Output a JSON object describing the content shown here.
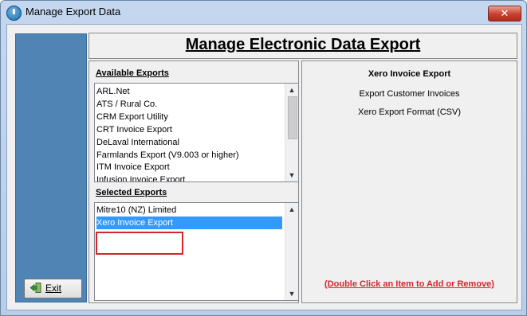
{
  "window": {
    "title": "Manage Export Data",
    "close_symbol": "✕"
  },
  "header": {
    "title": "Manage Electronic Data Export"
  },
  "sidebar": {
    "exit_label": "Exit"
  },
  "available": {
    "label": "Available Exports",
    "items": [
      "ARL.Net",
      "ATS / Rural Co.",
      "CRM Export Utility",
      "CRT Invoice Export",
      "DeLaval International",
      "Farmlands Export (V9.003 or higher)",
      "ITM Invoice Export",
      "Infusion Invoice Export"
    ],
    "scroll_position": 0.0
  },
  "selected": {
    "label": "Selected Exports",
    "items": [
      "Mitre10 (NZ) Limited",
      "Xero Invoice Export"
    ],
    "selected_index": 1
  },
  "details": {
    "heading": "Xero Invoice Export",
    "line1": "Export Customer Invoices",
    "line2": "Xero Export Format (CSV)",
    "hint": "(Double Click an Item to Add or Remove)"
  },
  "colors": {
    "sidebar": "#4f84b5",
    "selection": "#3399ff",
    "hint": "#d6262c",
    "annotation_box": "#d6262c"
  },
  "icons": {
    "app": "power-icon",
    "exit": "exit-door-icon",
    "close": "close-icon"
  }
}
